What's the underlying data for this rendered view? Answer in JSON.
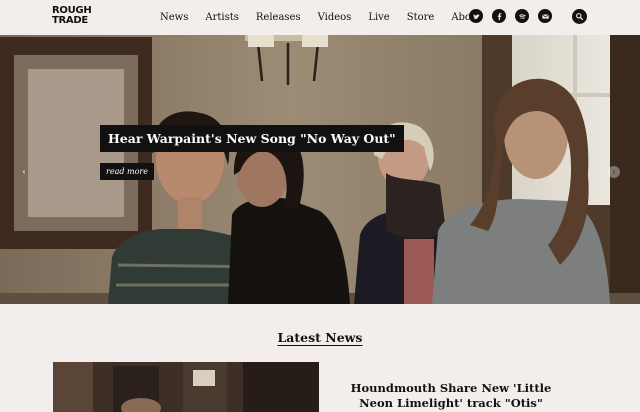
{
  "header": {
    "logo_line1": "ROUGH",
    "logo_line2": "TRADE",
    "nav": [
      "News",
      "Artists",
      "Releases",
      "Videos",
      "Live",
      "Store",
      "About"
    ],
    "social_icons": [
      "twitter-icon",
      "facebook-icon",
      "spotify-icon",
      "email-icon"
    ],
    "search_icon": "search-icon"
  },
  "hero": {
    "headline": "Hear Warpaint's New Song \"No Way Out\"",
    "read_more": "read more",
    "prev_arrow": "‹",
    "next_arrow": "›"
  },
  "news": {
    "section_title": "Latest News",
    "items": [
      {
        "headline": "Houndmouth Share New 'Little Neon Limelight' track \"Otis\""
      }
    ]
  },
  "colors": {
    "page_bg": "#f3eeec",
    "text": "#111111",
    "box_bg": "#111111"
  }
}
